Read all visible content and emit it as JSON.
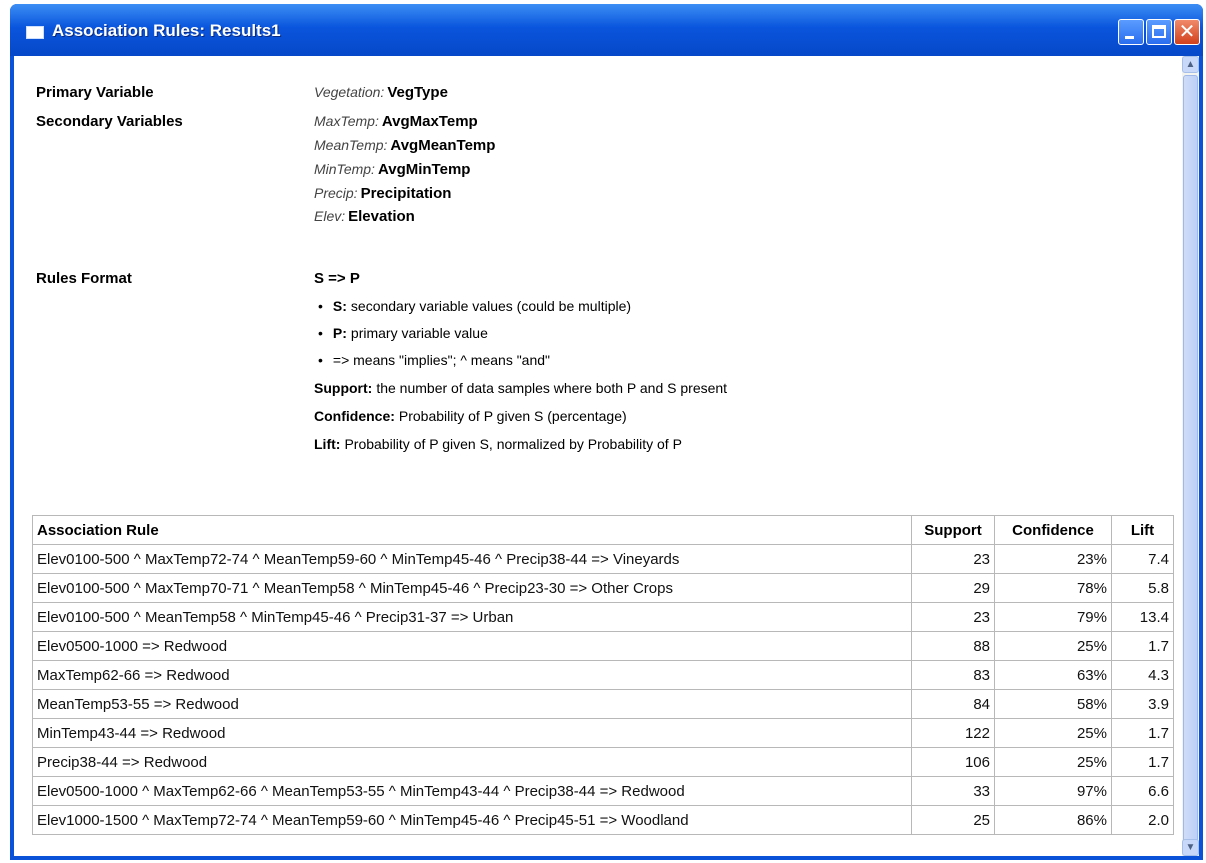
{
  "window": {
    "title": "Association Rules: Results1",
    "accent": "#0a52d8"
  },
  "primary": {
    "label": "Primary Variable",
    "prefix": "Vegetation:",
    "name": "VegType"
  },
  "secondary": {
    "label": "Secondary Variables",
    "vars": [
      {
        "prefix": "MaxTemp:",
        "name": "AvgMaxTemp"
      },
      {
        "prefix": "MeanTemp:",
        "name": "AvgMeanTemp"
      },
      {
        "prefix": "MinTemp:",
        "name": "AvgMinTemp"
      },
      {
        "prefix": "Precip:",
        "name": "Precipitation"
      },
      {
        "prefix": "Elev:",
        "name": "Elevation"
      }
    ]
  },
  "rules_format": {
    "label": "Rules Format",
    "formula": "S => P",
    "bullets": [
      {
        "term": "S:",
        "text": "secondary variable values (could be multiple)"
      },
      {
        "term": "P:",
        "text": "primary variable value"
      },
      {
        "term": "",
        "text": "=> means \"implies\"; ^ means \"and\""
      }
    ],
    "definitions": [
      {
        "term": "Support:",
        "text": "the number of data samples where both P and S present"
      },
      {
        "term": "Confidence:",
        "text": "Probability of P given S (percentage)"
      },
      {
        "term": "Lift:",
        "text": "Probability of P given S, normalized by Probability of P"
      }
    ]
  },
  "table": {
    "headers": [
      "Association Rule",
      "Support",
      "Confidence",
      "Lift"
    ],
    "rows": [
      [
        "Elev0100-500 ^ MaxTemp72-74 ^ MeanTemp59-60 ^ MinTemp45-46 ^ Precip38-44 => Vineyards",
        "23",
        "23%",
        "7.4"
      ],
      [
        "Elev0100-500 ^ MaxTemp70-71 ^ MeanTemp58 ^ MinTemp45-46 ^ Precip23-30 => Other Crops",
        "29",
        "78%",
        "5.8"
      ],
      [
        "Elev0100-500 ^ MeanTemp58 ^ MinTemp45-46 ^ Precip31-37 => Urban",
        "23",
        "79%",
        "13.4"
      ],
      [
        "Elev0500-1000 => Redwood",
        "88",
        "25%",
        "1.7"
      ],
      [
        "MaxTemp62-66 => Redwood",
        "83",
        "63%",
        "4.3"
      ],
      [
        "MeanTemp53-55 => Redwood",
        "84",
        "58%",
        "3.9"
      ],
      [
        "MinTemp43-44 => Redwood",
        "122",
        "25%",
        "1.7"
      ],
      [
        "Precip38-44 => Redwood",
        "106",
        "25%",
        "1.7"
      ],
      [
        "Elev0500-1000 ^ MaxTemp62-66 ^ MeanTemp53-55 ^ MinTemp43-44 ^ Precip38-44 => Redwood",
        "33",
        "97%",
        "6.6"
      ],
      [
        "Elev1000-1500 ^ MaxTemp72-74 ^ MeanTemp59-60 ^ MinTemp45-46 ^ Precip45-51 => Woodland",
        "25",
        "86%",
        "2.0"
      ]
    ]
  }
}
